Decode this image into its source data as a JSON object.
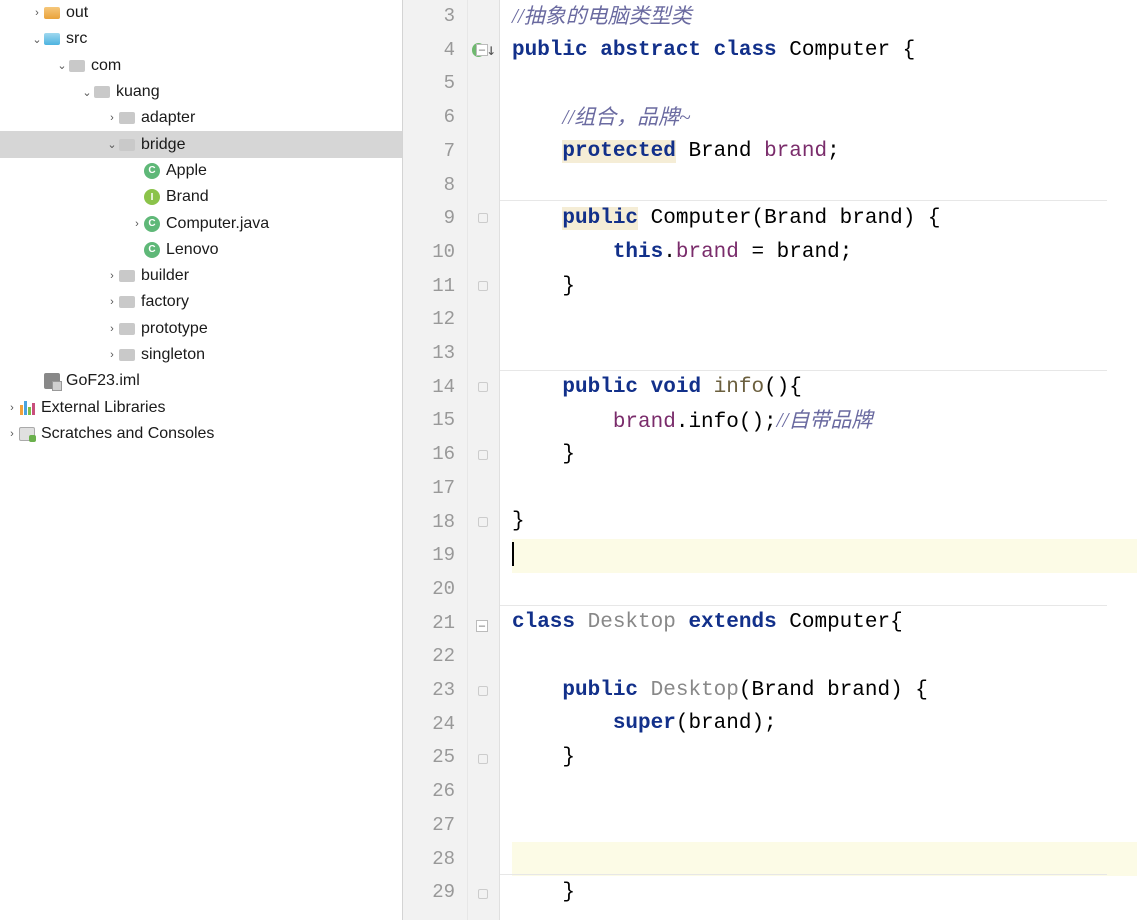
{
  "tree": {
    "out": "out",
    "src": "src",
    "com": "com",
    "kuang": "kuang",
    "adapter": "adapter",
    "bridge": "bridge",
    "apple": "Apple",
    "brand": "Brand",
    "computer": "Computer.java",
    "lenovo": "Lenovo",
    "builder": "builder",
    "factory": "factory",
    "prototype": "prototype",
    "singleton": "singleton",
    "iml": "GoF23.iml",
    "external": "External Libraries",
    "scratches": "Scratches and Consoles"
  },
  "arrows": {
    "right": "›",
    "down": "⌄"
  },
  "gutter": {
    "lines": [
      "3",
      "4",
      "5",
      "6",
      "7",
      "8",
      "9",
      "10",
      "11",
      "12",
      "13",
      "14",
      "15",
      "16",
      "17",
      "18",
      "19",
      "20",
      "21",
      "22",
      "23",
      "24",
      "25",
      "26",
      "27",
      "28",
      "29"
    ]
  },
  "code": {
    "c3": "//抽象的电脑类型类",
    "c4a": "public abstract class",
    "c4b": " Computer {",
    "c6": "//组合，品牌~",
    "c7a": "protected",
    "c7b": " Brand ",
    "c7c": "brand",
    "c7d": ";",
    "c9a": "public",
    "c9b": " Computer(Brand brand) {",
    "c10a": "this",
    "c10b": ".",
    "c10c": "brand",
    "c10d": " = brand;",
    "c11": "}",
    "c14a": "public void",
    "c14b": " ",
    "c14c": "info",
    "c14d": "(){",
    "c15a": "brand",
    "c15b": ".info();",
    "c15c": "//自带品牌",
    "c16": "}",
    "c18": "}",
    "c21a": "class",
    "c21b": " ",
    "c21c": "Desktop",
    "c21d": " ",
    "c21e": "extends",
    "c21f": " Computer{",
    "c23a": "public",
    "c23b": " ",
    "c23c": "Desktop",
    "c23d": "(Brand brand) {",
    "c24a": "super",
    "c24b": "(brand);",
    "c25": "}",
    "c29": "}"
  }
}
